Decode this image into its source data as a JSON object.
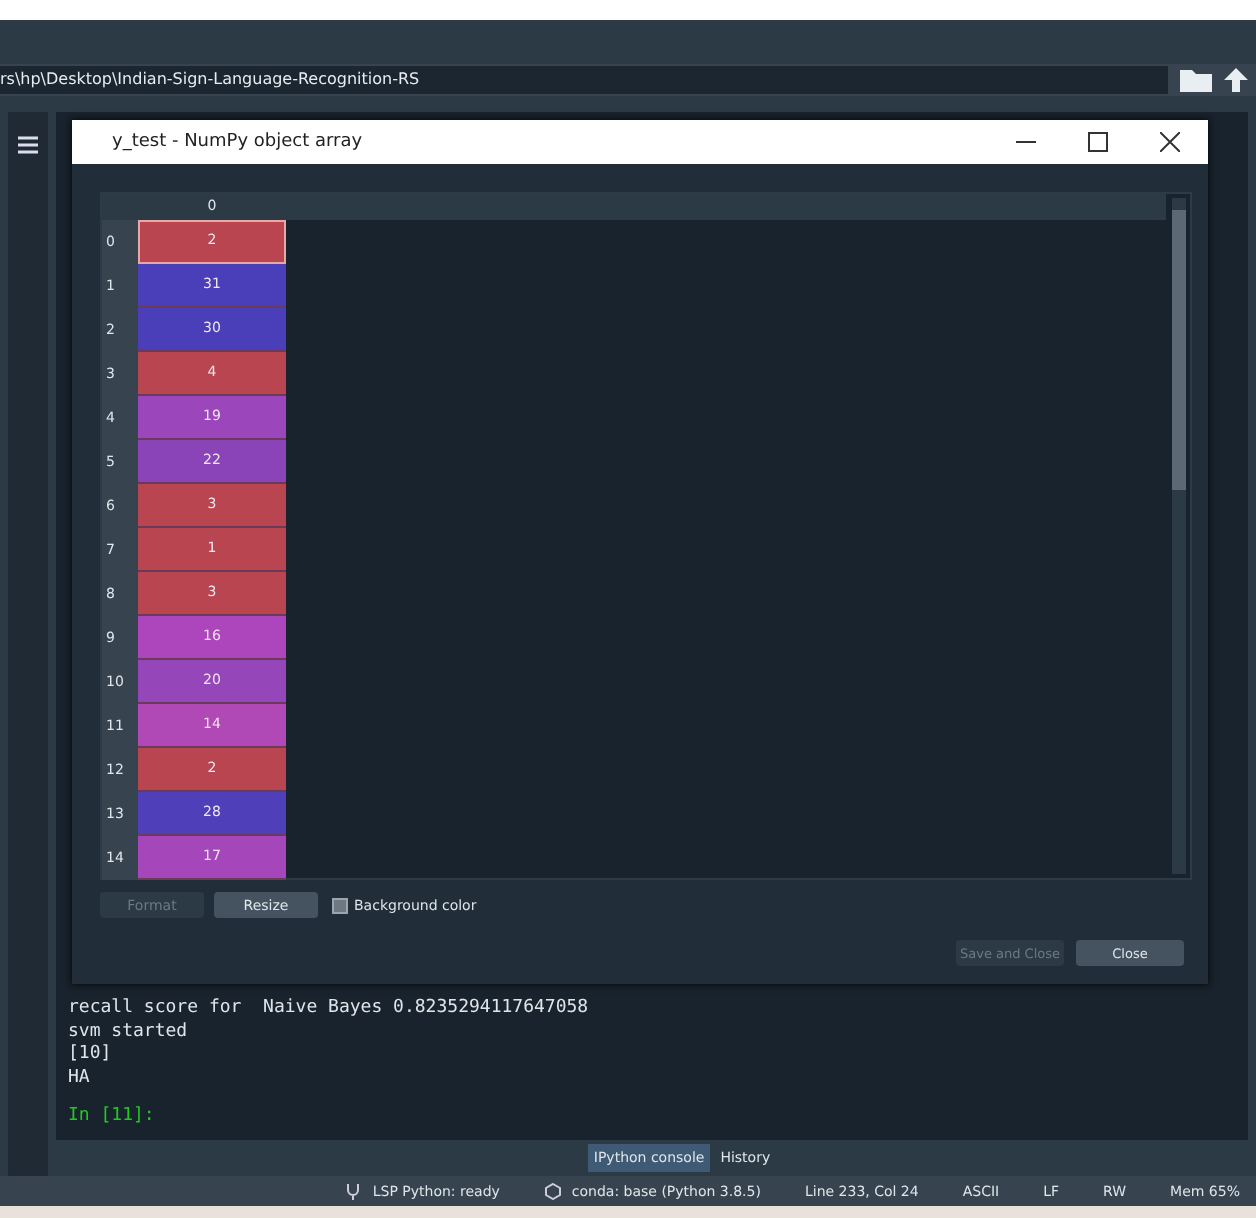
{
  "path_bar": {
    "path": "rs\\hp\\Desktop\\Indian-Sign-Language-Recognition-RS"
  },
  "dialog": {
    "title": "y_test - NumPy object array",
    "table": {
      "columns": [
        "0"
      ],
      "rows": [
        {
          "index": "0",
          "value": "2",
          "color": "#b8454f",
          "selected": true
        },
        {
          "index": "1",
          "value": "31",
          "color": "#4a3fb8",
          "selected": false
        },
        {
          "index": "2",
          "value": "30",
          "color": "#4a3fb8",
          "selected": false
        },
        {
          "index": "3",
          "value": "4",
          "color": "#b8454f",
          "selected": false
        },
        {
          "index": "4",
          "value": "19",
          "color": "#9c46bb",
          "selected": false
        },
        {
          "index": "5",
          "value": "22",
          "color": "#8a44b8",
          "selected": false
        },
        {
          "index": "6",
          "value": "3",
          "color": "#b8454f",
          "selected": false
        },
        {
          "index": "7",
          "value": "1",
          "color": "#b8454f",
          "selected": false
        },
        {
          "index": "8",
          "value": "3",
          "color": "#b8454f",
          "selected": false
        },
        {
          "index": "9",
          "value": "16",
          "color": "#ad46bd",
          "selected": false
        },
        {
          "index": "10",
          "value": "20",
          "color": "#9546b9",
          "selected": false
        },
        {
          "index": "11",
          "value": "14",
          "color": "#b048b5",
          "selected": false
        },
        {
          "index": "12",
          "value": "2",
          "color": "#b8454f",
          "selected": false
        },
        {
          "index": "13",
          "value": "28",
          "color": "#4f3fb8",
          "selected": false
        },
        {
          "index": "14",
          "value": "17",
          "color": "#a646bb",
          "selected": false
        }
      ]
    },
    "controls": [
      {
        "label": "Format",
        "disabled": true
      },
      {
        "label": "Resize",
        "disabled": false
      }
    ],
    "background_color": {
      "label": "Background color",
      "checked": true
    },
    "buttons": [
      {
        "label": "Save and Close",
        "disabled": true
      },
      {
        "label": "Close",
        "disabled": false
      }
    ]
  },
  "console": {
    "lines": [
      "recall score for  Naive Bayes 0.8235294117647058",
      "svm started",
      "[10]",
      "HA"
    ],
    "prompt": "In [11]:"
  },
  "pane_tabs": [
    {
      "label": "IPython console",
      "selected": true
    },
    {
      "label": "History",
      "selected": false
    }
  ],
  "status_bar": [
    {
      "kind": "lsp",
      "text": "LSP Python: ready"
    },
    {
      "kind": "conda",
      "text": "conda: base (Python 3.8.5)"
    },
    {
      "kind": "plain",
      "text": "Line 233, Col 24"
    },
    {
      "kind": "plain",
      "text": "ASCII"
    },
    {
      "kind": "plain",
      "text": "LF"
    },
    {
      "kind": "plain",
      "text": "RW"
    },
    {
      "kind": "plain",
      "text": "Mem 65%"
    }
  ]
}
